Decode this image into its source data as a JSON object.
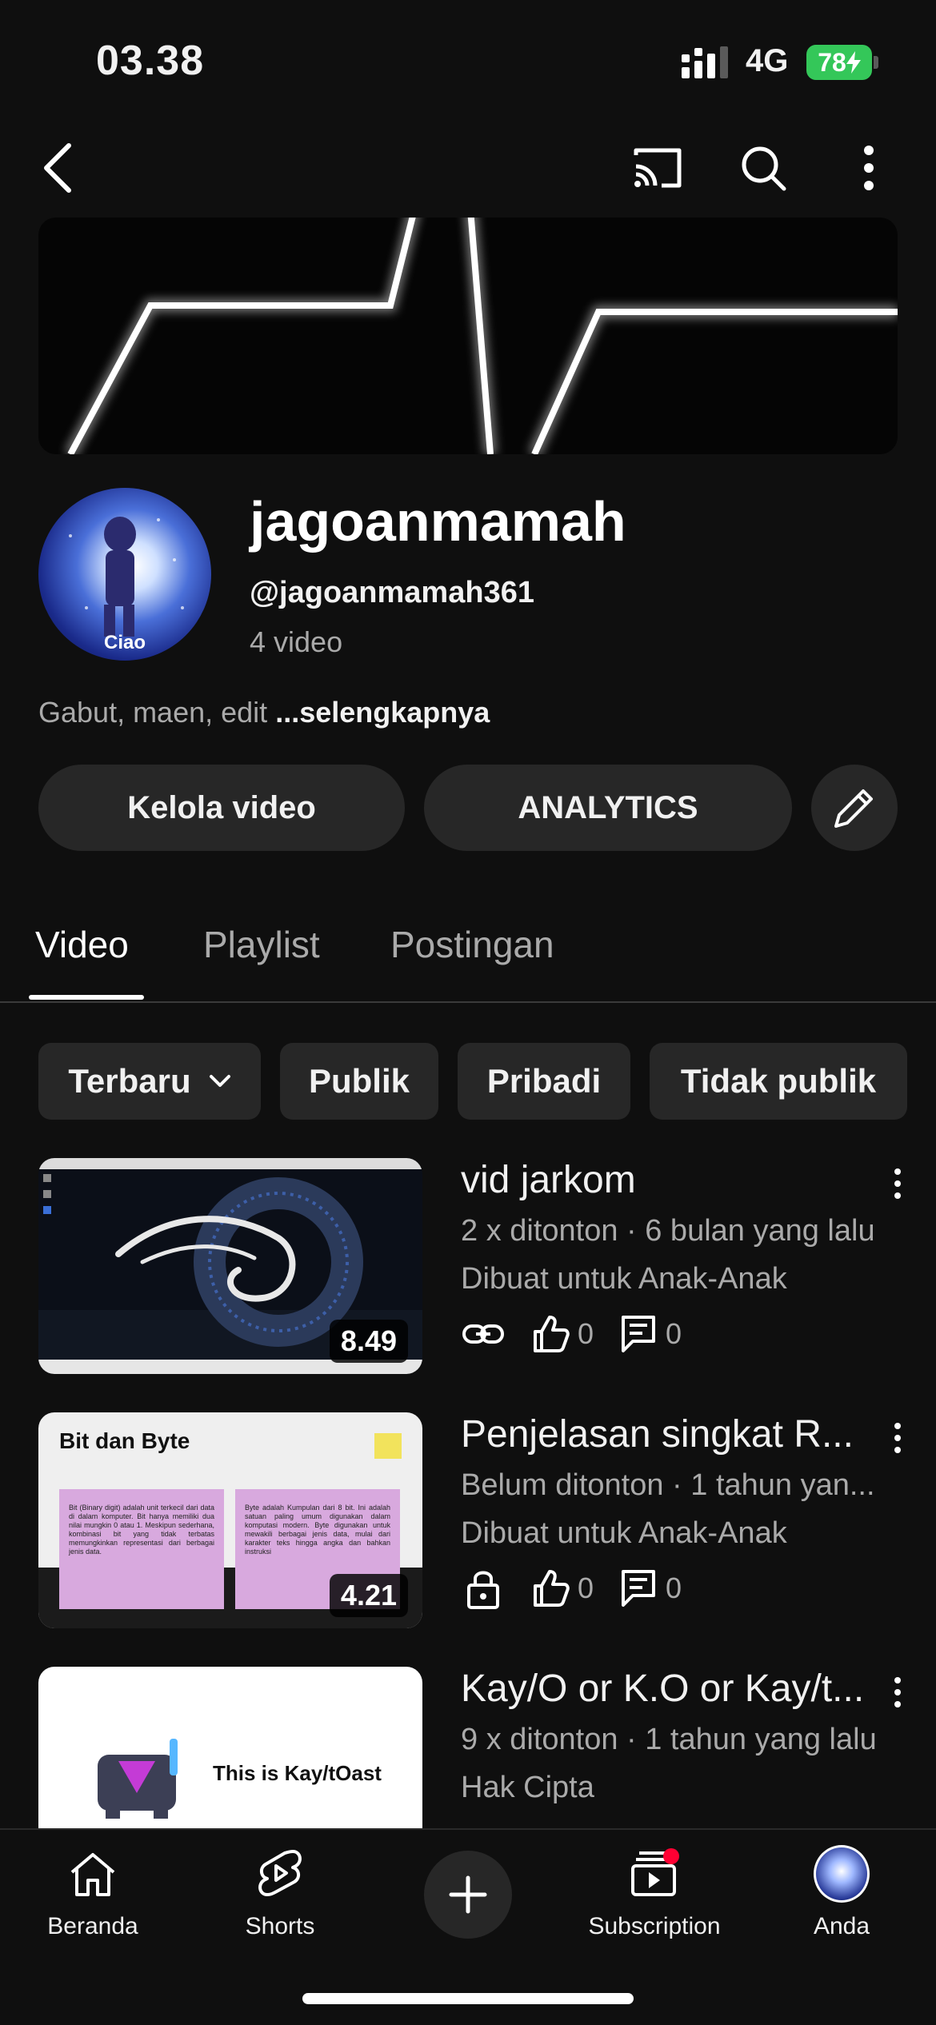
{
  "status_bar": {
    "time": "03.38",
    "network": "4G",
    "battery": "78"
  },
  "channel": {
    "name": "jagoanmamah",
    "handle": "@jagoanmamah361",
    "video_count": "4 video",
    "description": "Gabut, maen, edit",
    "more_link": "...selengkapnya",
    "avatar_caption": "Ciao"
  },
  "actions": {
    "manage": "Kelola video",
    "analytics": "ANALYTICS"
  },
  "tabs": [
    {
      "label": "Video",
      "active": true
    },
    {
      "label": "Playlist",
      "active": false
    },
    {
      "label": "Postingan",
      "active": false
    }
  ],
  "filters": {
    "sort": "Terbaru",
    "chips": [
      "Publik",
      "Pribadi",
      "Tidak publik"
    ]
  },
  "videos": [
    {
      "title": "vid jarkom",
      "meta": "2 x ditonton · 6 bulan yang lalu",
      "audience": "Dibuat untuk Anak-Anak",
      "duration": "8.49",
      "visibility_icon": "link-icon",
      "likes": "0",
      "comments": "0"
    },
    {
      "title": "Penjelasan singkat R...",
      "meta": "Belum ditonton · 1 tahun yan...",
      "audience": "Dibuat untuk Anak-Anak",
      "duration": "4.21",
      "visibility_icon": "lock-icon",
      "likes": "0",
      "comments": "0",
      "thumb_title": "Bit dan Byte",
      "thumb_left": "Bit (Binary digit) adalah unit terkecil dari data di dalam komputer. Bit hanya memiliki dua nilai mungkin 0 atau 1. Meskipun sederhana, kombinasi bit yang tidak terbatas memungkinkan representasi dari berbagai jenis data.",
      "thumb_right": "Byte adalah Kumpulan dari 8 bit. Ini adalah satuan paling umum digunakan dalam komputasi modern. Byte digunakan untuk mewakili berbagai jenis data, mulai dari karakter teks hingga angka dan bahkan instruksi"
    },
    {
      "title": "Kay/O or K.O or Kay/t...",
      "meta": "9 x ditonton · 1 tahun yang lalu",
      "audience": "Hak Cipta",
      "thumb_title": "This is Kay/tOast"
    }
  ],
  "bottom_nav": {
    "home": "Beranda",
    "shorts": "Shorts",
    "subscriptions": "Subscription",
    "you": "Anda"
  },
  "colors": {
    "background": "#0f0f0f",
    "surface": "#272727",
    "secondary_text": "#aaaaaa",
    "battery": "#34c759",
    "notification": "#ff0033"
  }
}
